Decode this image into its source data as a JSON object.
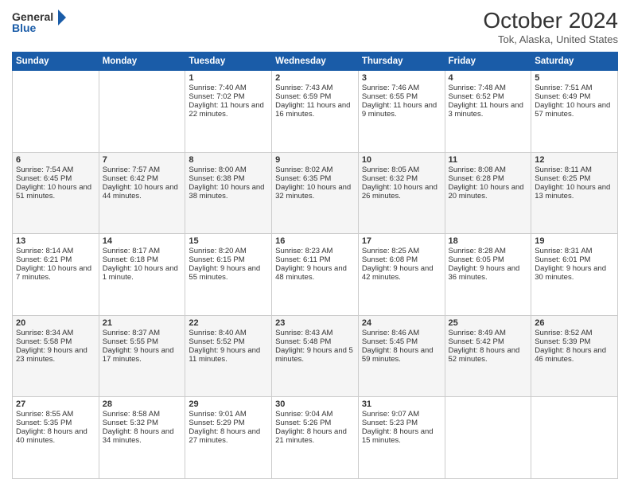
{
  "header": {
    "logo_line1": "General",
    "logo_line2": "Blue",
    "month": "October 2024",
    "location": "Tok, Alaska, United States"
  },
  "weekdays": [
    "Sunday",
    "Monday",
    "Tuesday",
    "Wednesday",
    "Thursday",
    "Friday",
    "Saturday"
  ],
  "weeks": [
    [
      {
        "day": "",
        "sunrise": "",
        "sunset": "",
        "daylight": ""
      },
      {
        "day": "",
        "sunrise": "",
        "sunset": "",
        "daylight": ""
      },
      {
        "day": "1",
        "sunrise": "Sunrise: 7:40 AM",
        "sunset": "Sunset: 7:02 PM",
        "daylight": "Daylight: 11 hours and 22 minutes."
      },
      {
        "day": "2",
        "sunrise": "Sunrise: 7:43 AM",
        "sunset": "Sunset: 6:59 PM",
        "daylight": "Daylight: 11 hours and 16 minutes."
      },
      {
        "day": "3",
        "sunrise": "Sunrise: 7:46 AM",
        "sunset": "Sunset: 6:55 PM",
        "daylight": "Daylight: 11 hours and 9 minutes."
      },
      {
        "day": "4",
        "sunrise": "Sunrise: 7:48 AM",
        "sunset": "Sunset: 6:52 PM",
        "daylight": "Daylight: 11 hours and 3 minutes."
      },
      {
        "day": "5",
        "sunrise": "Sunrise: 7:51 AM",
        "sunset": "Sunset: 6:49 PM",
        "daylight": "Daylight: 10 hours and 57 minutes."
      }
    ],
    [
      {
        "day": "6",
        "sunrise": "Sunrise: 7:54 AM",
        "sunset": "Sunset: 6:45 PM",
        "daylight": "Daylight: 10 hours and 51 minutes."
      },
      {
        "day": "7",
        "sunrise": "Sunrise: 7:57 AM",
        "sunset": "Sunset: 6:42 PM",
        "daylight": "Daylight: 10 hours and 44 minutes."
      },
      {
        "day": "8",
        "sunrise": "Sunrise: 8:00 AM",
        "sunset": "Sunset: 6:38 PM",
        "daylight": "Daylight: 10 hours and 38 minutes."
      },
      {
        "day": "9",
        "sunrise": "Sunrise: 8:02 AM",
        "sunset": "Sunset: 6:35 PM",
        "daylight": "Daylight: 10 hours and 32 minutes."
      },
      {
        "day": "10",
        "sunrise": "Sunrise: 8:05 AM",
        "sunset": "Sunset: 6:32 PM",
        "daylight": "Daylight: 10 hours and 26 minutes."
      },
      {
        "day": "11",
        "sunrise": "Sunrise: 8:08 AM",
        "sunset": "Sunset: 6:28 PM",
        "daylight": "Daylight: 10 hours and 20 minutes."
      },
      {
        "day": "12",
        "sunrise": "Sunrise: 8:11 AM",
        "sunset": "Sunset: 6:25 PM",
        "daylight": "Daylight: 10 hours and 13 minutes."
      }
    ],
    [
      {
        "day": "13",
        "sunrise": "Sunrise: 8:14 AM",
        "sunset": "Sunset: 6:21 PM",
        "daylight": "Daylight: 10 hours and 7 minutes."
      },
      {
        "day": "14",
        "sunrise": "Sunrise: 8:17 AM",
        "sunset": "Sunset: 6:18 PM",
        "daylight": "Daylight: 10 hours and 1 minute."
      },
      {
        "day": "15",
        "sunrise": "Sunrise: 8:20 AM",
        "sunset": "Sunset: 6:15 PM",
        "daylight": "Daylight: 9 hours and 55 minutes."
      },
      {
        "day": "16",
        "sunrise": "Sunrise: 8:23 AM",
        "sunset": "Sunset: 6:11 PM",
        "daylight": "Daylight: 9 hours and 48 minutes."
      },
      {
        "day": "17",
        "sunrise": "Sunrise: 8:25 AM",
        "sunset": "Sunset: 6:08 PM",
        "daylight": "Daylight: 9 hours and 42 minutes."
      },
      {
        "day": "18",
        "sunrise": "Sunrise: 8:28 AM",
        "sunset": "Sunset: 6:05 PM",
        "daylight": "Daylight: 9 hours and 36 minutes."
      },
      {
        "day": "19",
        "sunrise": "Sunrise: 8:31 AM",
        "sunset": "Sunset: 6:01 PM",
        "daylight": "Daylight: 9 hours and 30 minutes."
      }
    ],
    [
      {
        "day": "20",
        "sunrise": "Sunrise: 8:34 AM",
        "sunset": "Sunset: 5:58 PM",
        "daylight": "Daylight: 9 hours and 23 minutes."
      },
      {
        "day": "21",
        "sunrise": "Sunrise: 8:37 AM",
        "sunset": "Sunset: 5:55 PM",
        "daylight": "Daylight: 9 hours and 17 minutes."
      },
      {
        "day": "22",
        "sunrise": "Sunrise: 8:40 AM",
        "sunset": "Sunset: 5:52 PM",
        "daylight": "Daylight: 9 hours and 11 minutes."
      },
      {
        "day": "23",
        "sunrise": "Sunrise: 8:43 AM",
        "sunset": "Sunset: 5:48 PM",
        "daylight": "Daylight: 9 hours and 5 minutes."
      },
      {
        "day": "24",
        "sunrise": "Sunrise: 8:46 AM",
        "sunset": "Sunset: 5:45 PM",
        "daylight": "Daylight: 8 hours and 59 minutes."
      },
      {
        "day": "25",
        "sunrise": "Sunrise: 8:49 AM",
        "sunset": "Sunset: 5:42 PM",
        "daylight": "Daylight: 8 hours and 52 minutes."
      },
      {
        "day": "26",
        "sunrise": "Sunrise: 8:52 AM",
        "sunset": "Sunset: 5:39 PM",
        "daylight": "Daylight: 8 hours and 46 minutes."
      }
    ],
    [
      {
        "day": "27",
        "sunrise": "Sunrise: 8:55 AM",
        "sunset": "Sunset: 5:35 PM",
        "daylight": "Daylight: 8 hours and 40 minutes."
      },
      {
        "day": "28",
        "sunrise": "Sunrise: 8:58 AM",
        "sunset": "Sunset: 5:32 PM",
        "daylight": "Daylight: 8 hours and 34 minutes."
      },
      {
        "day": "29",
        "sunrise": "Sunrise: 9:01 AM",
        "sunset": "Sunset: 5:29 PM",
        "daylight": "Daylight: 8 hours and 27 minutes."
      },
      {
        "day": "30",
        "sunrise": "Sunrise: 9:04 AM",
        "sunset": "Sunset: 5:26 PM",
        "daylight": "Daylight: 8 hours and 21 minutes."
      },
      {
        "day": "31",
        "sunrise": "Sunrise: 9:07 AM",
        "sunset": "Sunset: 5:23 PM",
        "daylight": "Daylight: 8 hours and 15 minutes."
      },
      {
        "day": "",
        "sunrise": "",
        "sunset": "",
        "daylight": ""
      },
      {
        "day": "",
        "sunrise": "",
        "sunset": "",
        "daylight": ""
      }
    ]
  ]
}
